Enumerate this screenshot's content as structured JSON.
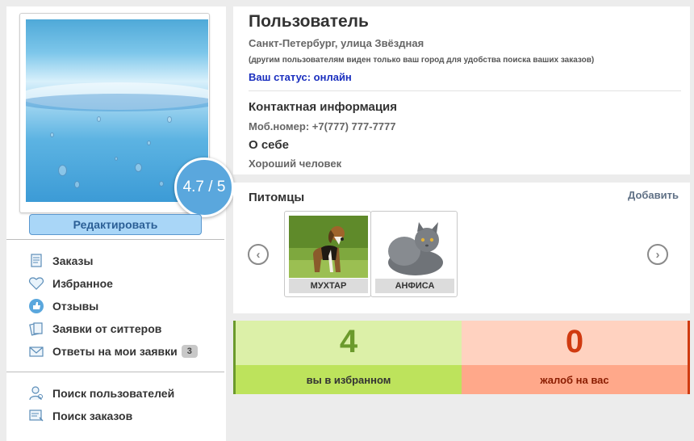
{
  "profile": {
    "rating": "4.7 / 5",
    "edit_label": "Редактировать",
    "name": "Пользователь",
    "address": "Санкт-Петербург, улица Звёздная",
    "address_note": "(другим пользователям виден только ваш город для удобства поиска ваших заказов)",
    "status": "Ваш статус: онлайн",
    "contact_heading": "Контактная информация",
    "phone": "Моб.номер: +7(777) 777-7777",
    "about_heading": "О себе",
    "about_text": "Хороший человек"
  },
  "sidebar": {
    "items": [
      {
        "label": "Заказы",
        "icon": "orders-icon"
      },
      {
        "label": "Избранное",
        "icon": "heart-icon"
      },
      {
        "label": "Отзывы",
        "icon": "thumbs-up-icon"
      },
      {
        "label": "Заявки от ситтеров",
        "icon": "requests-icon"
      },
      {
        "label": "Ответы на мои заявки",
        "icon": "mail-icon",
        "badge": "3"
      }
    ],
    "search_items": [
      {
        "label": "Поиск пользователей",
        "icon": "user-search-icon"
      },
      {
        "label": "Поиск заказов",
        "icon": "order-search-icon"
      }
    ]
  },
  "pets": {
    "title": "Питомцы",
    "add_label": "Добавить",
    "items": [
      {
        "name": "МУХТАР",
        "kind": "dog"
      },
      {
        "name": "АНФИСА",
        "kind": "cat"
      }
    ]
  },
  "stats": {
    "favorites": {
      "value": "4",
      "label": "вы в избранном",
      "color": "#6b9a2c",
      "bg": "#dcf0a8",
      "label_bg": "#bde35c"
    },
    "complaints": {
      "value": "0",
      "label": "жалоб на вас",
      "color": "#d03a10",
      "bg": "#ffd2c0",
      "label_bg": "#ffa88a"
    }
  },
  "colors": {
    "accent": "#5aa7dd",
    "status": "#1a2fbf"
  }
}
